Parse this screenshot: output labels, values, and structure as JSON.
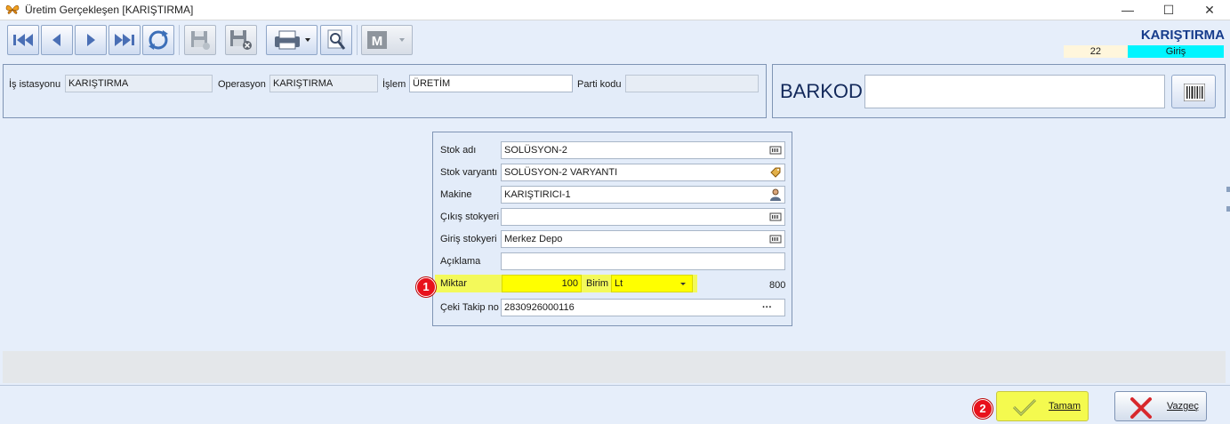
{
  "window": {
    "title": "Üretim Gerçekleşen [KARIŞTIRMA]",
    "controls": [
      "—",
      "☐",
      "✕"
    ]
  },
  "header": {
    "title": "KARIŞTIRMA",
    "number": "22",
    "status": "Giriş",
    "status_color": "#00f5ff"
  },
  "top_group": {
    "is_istasyonu_label": "İş istasyonu",
    "is_istasyonu_value": "KARIŞTIRMA",
    "operasyon_label": "Operasyon",
    "operasyon_value": "KARIŞTIRMA",
    "islem_label": "İşlem",
    "islem_value": "ÜRETİM",
    "parti_kodu_label": "Parti kodu",
    "parti_kodu_value": ""
  },
  "barkod": {
    "label": "BARKOD",
    "value": ""
  },
  "form": {
    "stok_adi_label": "Stok adı",
    "stok_adi_value": "SOLÜSYON-2",
    "stok_varyanti_label": "Stok varyantı",
    "stok_varyanti_value": "SOLÜSYON-2 VARYANTI",
    "makine_label": "Makine",
    "makine_value": "KARIŞTIRICI-1",
    "cikis_stokyeri_label": "Çıkış stokyeri",
    "cikis_stokyeri_value": "",
    "giris_stokyeri_label": "Giriş stokyeri",
    "giris_stokyeri_value": "Merkez Depo",
    "aciklama_label": "Açıklama",
    "aciklama_value": "",
    "miktar_label": "Miktar",
    "miktar_value": "100",
    "birim_label": "Birim",
    "birim_value": "Lt",
    "right_value": "800",
    "ceki_takip_label": "Çeki Takip no",
    "ceki_takip_value": "2830926000116",
    "ellipsis": "···"
  },
  "markers": {
    "one": "1",
    "two": "2"
  },
  "buttons": {
    "tamam": "Tamam",
    "vazgec": "Vazgeç"
  },
  "colors": {
    "highlight": "#ffff00",
    "marker": "#e8111b"
  }
}
